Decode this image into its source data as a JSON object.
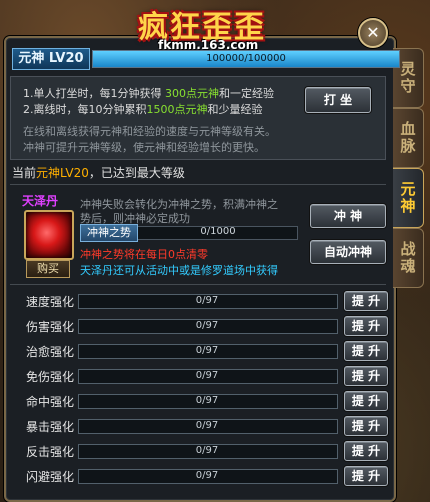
{
  "logo": {
    "title": "疯狂歪歪",
    "url": "fkmm.163.com"
  },
  "tabs": [
    "灵守",
    "血脉",
    "元神",
    "战魂"
  ],
  "level": {
    "badge": "元神 LV20",
    "progress_text": "100000/100000",
    "progress": 1.0
  },
  "info": {
    "line1_a": "1.单人打坐时，每1分钟获得 ",
    "line1_b": "300点元神",
    "line1_c": "和一定经验",
    "line2_a": "2.离线时，每10分钟累积",
    "line2_b": "1500点元神",
    "line2_c": "和少量经验",
    "desc1": "在线和离线获得元神和经验的速度与元神等级有关。",
    "desc2": "冲神可提升元神等级，使元神和经验增长的更快。",
    "meditate_button": "打 坐"
  },
  "current": {
    "prefix": "当前",
    "level": "元神LV20",
    "suffix": "，已达到最大等级"
  },
  "pill": {
    "name": "天泽丹",
    "buy": "购买",
    "desc1": "冲神失败会转化为冲神之势，积满冲神之",
    "desc2": "势后，则冲神必定成功",
    "momentum_label": "冲神之势",
    "momentum_value": "0/1000",
    "warn": "冲神之势将在每日0点清零",
    "source": "天泽丹还可从活动中或是修罗道场中获得",
    "charge_button": "冲 神",
    "auto_button": "自动冲神"
  },
  "stats": [
    {
      "name": "速度强化",
      "value": "0/97",
      "button": "提 升"
    },
    {
      "name": "伤害强化",
      "value": "0/97",
      "button": "提 升"
    },
    {
      "name": "治愈强化",
      "value": "0/97",
      "button": "提 升"
    },
    {
      "name": "免伤强化",
      "value": "0/97",
      "button": "提 升"
    },
    {
      "name": "命中强化",
      "value": "0/97",
      "button": "提 升"
    },
    {
      "name": "暴击强化",
      "value": "0/97",
      "button": "提 升"
    },
    {
      "name": "反击强化",
      "value": "0/97",
      "button": "提 升"
    },
    {
      "name": "闪避强化",
      "value": "0/97",
      "button": "提 升"
    }
  ]
}
